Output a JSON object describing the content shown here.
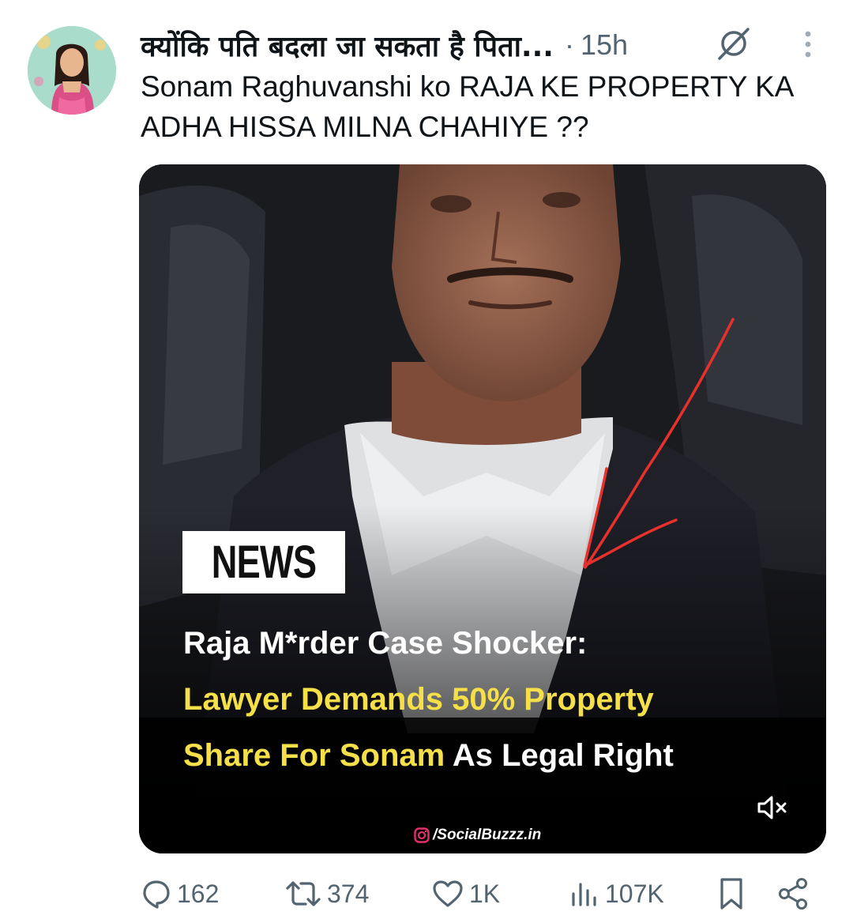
{
  "post": {
    "author_name": "क्योंकि पति बदला जा सकता है पिता...",
    "separator": "·",
    "time": "15h",
    "text": "Sonam Raghuvanshi ko RAJA KE PROPERTY KA ADHA HISSA MILNA CHAHIYE ??"
  },
  "media": {
    "badge": "NEWS",
    "headline_line1": "Raja M*rder Case Shocker:",
    "headline_line2": "Lawyer Demands 50% Property",
    "headline_line3_yellow": "Share For Sonam",
    "headline_line3_white": " As Legal Right",
    "source": "/SocialBuzzz.in",
    "colors": {
      "headline_yellow": "#f5e04a",
      "annotation_arrow": "#e8302c"
    }
  },
  "actions": {
    "replies": "162",
    "reposts": "374",
    "likes": "1K",
    "views": "107K"
  },
  "icons": [
    "grok-icon",
    "more-icon",
    "mute-icon",
    "instagram-icon",
    "reply-icon",
    "repost-icon",
    "like-icon",
    "views-icon",
    "bookmark-icon",
    "share-icon"
  ],
  "colors": {
    "text_primary": "#0f1419",
    "text_secondary": "#536471"
  }
}
